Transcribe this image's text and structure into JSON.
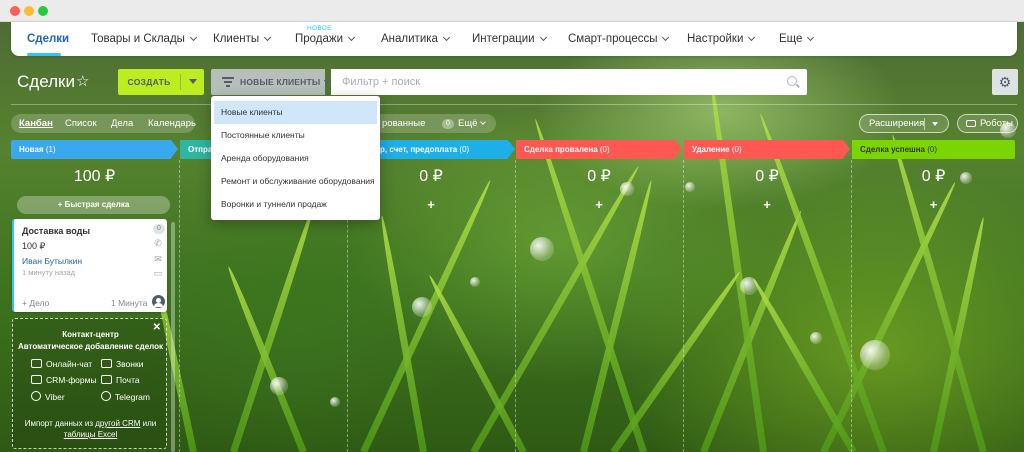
{
  "topnav": {
    "items": [
      {
        "label": "Сделки",
        "active": true
      },
      {
        "label": "Товары и Склады"
      },
      {
        "label": "Клиенты"
      },
      {
        "label": "Продажи",
        "badge": "НОВОЕ"
      },
      {
        "label": "Аналитика"
      },
      {
        "label": "Интеграции"
      },
      {
        "label": "Смарт-процессы"
      },
      {
        "label": "Настройки"
      },
      {
        "label": "Еще"
      }
    ]
  },
  "toolbar": {
    "title": "Сделки",
    "create_label": "СОЗДАТЬ",
    "filter_label": "НОВЫЕ КЛИЕНТЫ",
    "search_placeholder": "Фильтр + поиск"
  },
  "views": {
    "tabs": [
      "Канбан",
      "Список",
      "Дела",
      "Календарь"
    ],
    "partial_label": "рованные",
    "more_count": "0",
    "more_label": "Ещё"
  },
  "right_buttons": {
    "extensions": "Расширения",
    "robots": "Роботы"
  },
  "dropdown": {
    "items": [
      "Новые клиенты",
      "Постоянные клиенты",
      "Аренда оборудования",
      "Ремонт и обслуживание оборудования",
      "Воронки и туннели продаж"
    ],
    "selected": "Новые клиенты"
  },
  "columns": [
    {
      "title": "Новая",
      "count": "(1)",
      "sum": "100 ₽",
      "color": "#39a8ef"
    },
    {
      "title": "Отправ",
      "count": "",
      "sum": "",
      "color": "#2fb5a4"
    },
    {
      "title": "р, счет, предоплата",
      "count": "(0)",
      "sum": "0 ₽",
      "color": "#1eaee8"
    },
    {
      "title": "Сделка провалена",
      "count": "(0)",
      "sum": "0 ₽",
      "color": "#ff5752"
    },
    {
      "title": "Удаление",
      "count": "(0)",
      "sum": "0 ₽",
      "color": "#ff5752"
    },
    {
      "title": "Сделка успешна",
      "count": "(0)",
      "sum": "0 ₽",
      "color": "#7bd500"
    }
  ],
  "quick_deal_label": "+ Быстрая сделка",
  "plus_glyph": "+",
  "deal_card": {
    "name": "Доставка воды",
    "sum": "100 ₽",
    "client": "Иван Бутылкин",
    "time": "1 минуту назад",
    "activities_count": "0",
    "add_case": "+ Дело",
    "minute_label": "1 Минута"
  },
  "contact_center": {
    "title": "Контакт-центр",
    "subtitle": "Автоматическое добавление сделок",
    "channels": [
      "Онлайн-чат",
      "Звонки",
      "CRM-формы",
      "Почта",
      "Viber",
      "Telegram"
    ],
    "import_text_1": "Импорт данных из ",
    "import_link_1": "другой CRM",
    "import_text_2": " или ",
    "import_link_2": "таблицы Excel"
  }
}
